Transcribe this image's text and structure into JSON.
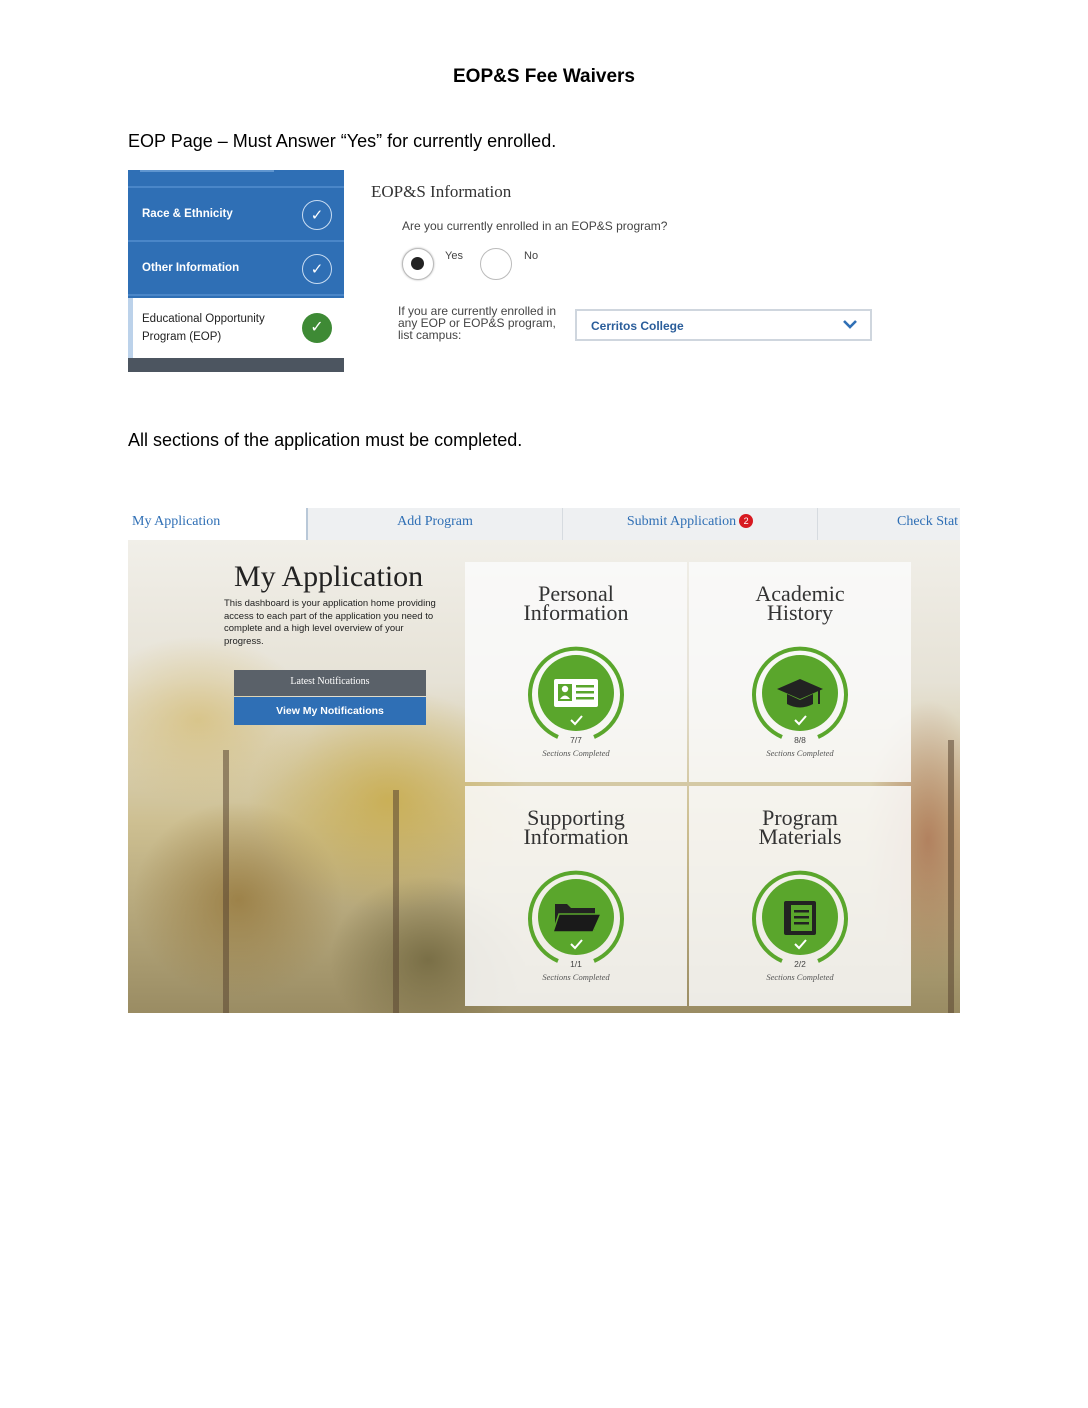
{
  "document": {
    "title": "EOP&S Fee Waivers",
    "para_eop": "EOP Page – Must Answer “Yes” for currently enrolled.",
    "para_sections": "All sections of the application must be completed."
  },
  "eop_screen": {
    "sidebar": {
      "items": [
        {
          "label": "Race & Ethnicity",
          "status": "complete"
        },
        {
          "label": "Other Information",
          "status": "complete"
        }
      ],
      "active_item": {
        "line1": "Educational Opportunity",
        "line2": "Program (EOP)",
        "status": "complete"
      }
    },
    "heading": "EOP&S Information",
    "question": "Are you currently enrolled in an EOP&S program?",
    "options": {
      "yes": "Yes",
      "no": "No",
      "selected": "Yes"
    },
    "campus_label": "If you are currently enrolled in any EOP or EOP&S program, list campus:",
    "campus_value": "Cerritos College"
  },
  "dashboard": {
    "tabs": {
      "my_application": "My Application",
      "add_program": "Add Program",
      "submit_application": "Submit Application",
      "submit_badge": "2",
      "check_status": "Check Stat"
    },
    "title": "My Application",
    "intro": "This dashboard is your application home providing access to each part of the application you need to complete and a high level overview of your progress.",
    "latest_notifications": "Latest Notifications",
    "view_notifications": "View My Notifications",
    "cards": [
      {
        "title_line1": "Personal",
        "title_line2": "Information",
        "count": "7/7",
        "caption": "Sections Completed",
        "icon": "id-card-icon"
      },
      {
        "title_line1": "Academic",
        "title_line2": "History",
        "count": "8/8",
        "caption": "Sections Completed",
        "icon": "graduation-cap-icon"
      },
      {
        "title_line1": "Supporting",
        "title_line2": "Information",
        "count": "1/1",
        "caption": "Sections Completed",
        "icon": "folder-icon"
      },
      {
        "title_line1": "Program",
        "title_line2": "Materials",
        "count": "2/2",
        "caption": "Sections Completed",
        "icon": "book-icon"
      }
    ],
    "colors": {
      "accent_blue": "#2f6fb5",
      "progress_green": "#5aa62c",
      "badge_red": "#d71920"
    }
  }
}
